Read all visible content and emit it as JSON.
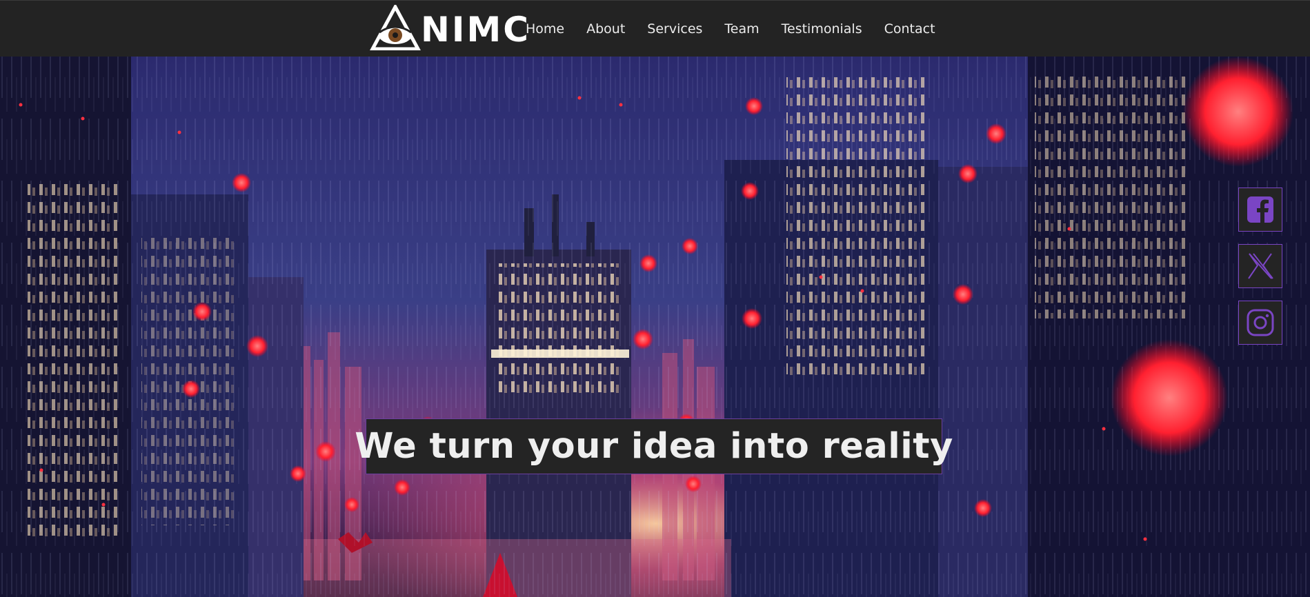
{
  "brand": {
    "logo_text": "NIMC"
  },
  "nav": {
    "items": [
      {
        "label": "Home"
      },
      {
        "label": "About"
      },
      {
        "label": "Services"
      },
      {
        "label": "Team"
      },
      {
        "label": "Testimonials"
      },
      {
        "label": "Contact"
      }
    ]
  },
  "hero": {
    "headline": "We turn your idea into reality",
    "background_icon": "rainy-neon-city-illustration"
  },
  "social": [
    {
      "icon": "facebook-icon"
    },
    {
      "icon": "x-twitter-icon"
    },
    {
      "icon": "instagram-icon"
    }
  ],
  "colors": {
    "nav_bg": "#232323",
    "accent_purple": "#7a45c4",
    "lantern_red": "#ff2a3a",
    "sky_top": "#2b2a6e",
    "headline_bg": "#242424"
  }
}
